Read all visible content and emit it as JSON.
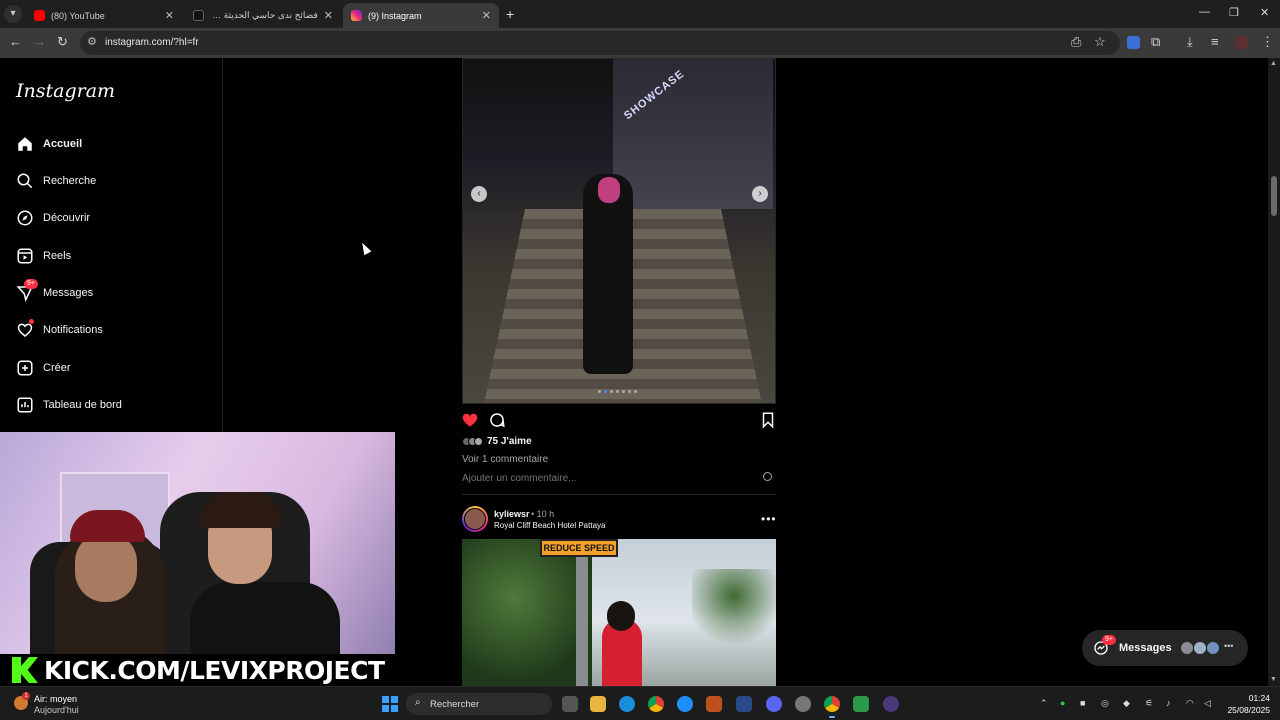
{
  "browser": {
    "tabs": [
      {
        "title": "(80) YouTube",
        "icon": "youtube-icon",
        "color": "#ff0000"
      },
      {
        "title": "فضائح ندى حاسي الحديثة ورياح…",
        "icon": "tiktok-icon",
        "color": "#000000"
      },
      {
        "title": "(9) Instagram",
        "icon": "instagram-icon",
        "color": "#e1306c"
      }
    ],
    "url": "instagram.com/?hl=fr"
  },
  "sidebar": {
    "logo": "Instagram",
    "items": [
      {
        "label": "Accueil",
        "icon": "home-icon"
      },
      {
        "label": "Recherche",
        "icon": "search-icon"
      },
      {
        "label": "Découvrir",
        "icon": "compass-icon"
      },
      {
        "label": "Reels",
        "icon": "reels-icon"
      },
      {
        "label": "Messages",
        "icon": "messenger-icon",
        "badge": "9+"
      },
      {
        "label": "Notifications",
        "icon": "heart-icon"
      },
      {
        "label": "Créer",
        "icon": "plus-square-icon"
      },
      {
        "label": "Tableau de bord",
        "icon": "dashboard-icon"
      }
    ]
  },
  "feed": {
    "post1": {
      "sign_text": "SHOWCASE",
      "carousel_prev": "‹",
      "carousel_next": "›",
      "likes": "75 J'aime",
      "comments_link": "Voir 1 commentaire",
      "comment_placeholder": "Ajouter un commentaire..."
    },
    "post2": {
      "username": "kyliewsr",
      "time": "• 10 h",
      "location": "Royal Cliff Beach Hotel Pattaya",
      "sign_text": "REDUCE SPEED"
    }
  },
  "messages_pill": {
    "label": "Messages",
    "badge": "9+"
  },
  "overlay": {
    "kick_text": "KICK.COM/LEVIXPROJECT"
  },
  "taskbar": {
    "weather_line1": "Air: moyen",
    "weather_line2": "Aujourd'hui",
    "weather_badge": "1",
    "search_placeholder": "Rechercher",
    "time": "01:24",
    "date": "25/08/2025"
  },
  "colors": {
    "like_red": "#ff3040",
    "ig_bg": "#000000",
    "kick_green": "#53fc18"
  }
}
